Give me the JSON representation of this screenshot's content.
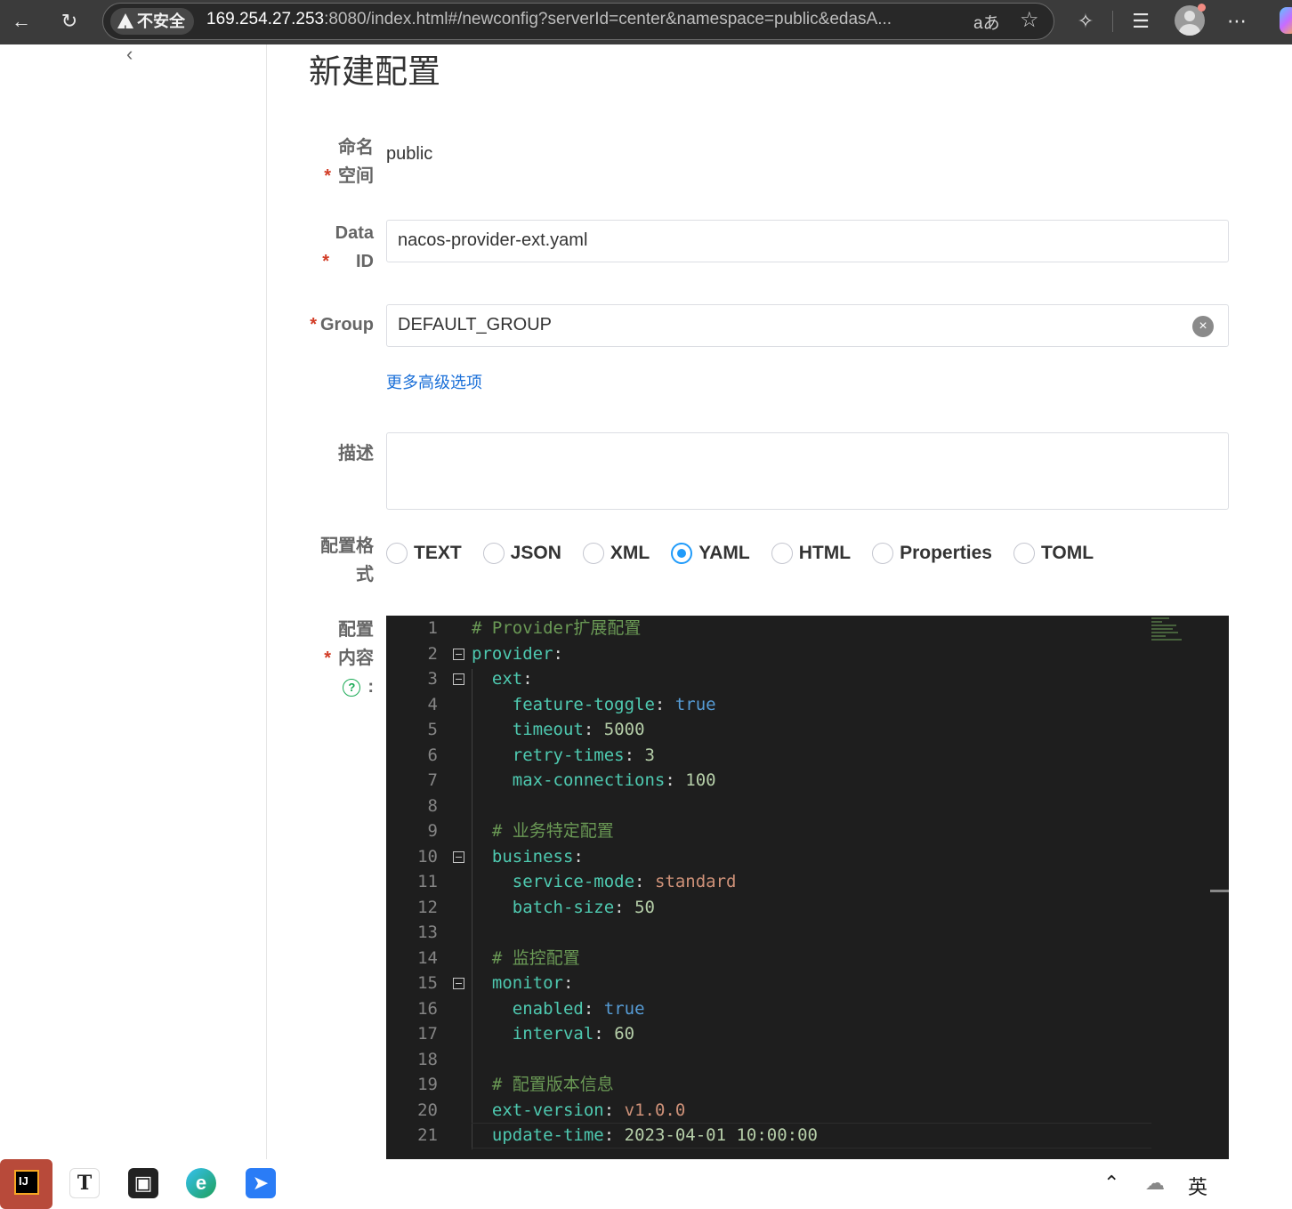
{
  "browser": {
    "security_label": "不安全",
    "url_host": "169.254.27.253",
    "url_rest": ":8080/index.html#/newconfig?serverId=center&namespace=public&edasA...",
    "read_aloud": "aあ"
  },
  "page": {
    "title": "新建配置"
  },
  "form": {
    "namespace": {
      "required": "*",
      "label": "命名空间",
      "value": "public"
    },
    "data_id": {
      "required": "*",
      "label": "Data ID",
      "value": "nacos-provider-ext.yaml"
    },
    "group": {
      "required": "*",
      "label": "Group",
      "value": "DEFAULT_GROUP"
    },
    "advanced_link": "更多高级选项",
    "description": {
      "label": "描述",
      "value": ""
    },
    "format": {
      "label": "配置格式",
      "options": [
        "TEXT",
        "JSON",
        "XML",
        "YAML",
        "HTML",
        "Properties",
        "TOML"
      ],
      "selected": "YAML"
    },
    "content": {
      "required": "*",
      "label": "配置内容",
      "help": "?",
      "colon": ":"
    }
  },
  "editor": {
    "lines": [
      {
        "n": "1",
        "text": "# Provider扩展配置"
      },
      {
        "n": "2",
        "text": "provider:"
      },
      {
        "n": "3",
        "text": "  ext:"
      },
      {
        "n": "4",
        "text": "    feature-toggle: true"
      },
      {
        "n": "5",
        "text": "    timeout: 5000"
      },
      {
        "n": "6",
        "text": "    retry-times: 3"
      },
      {
        "n": "7",
        "text": "    max-connections: 100"
      },
      {
        "n": "8",
        "text": ""
      },
      {
        "n": "9",
        "text": "  # 业务特定配置"
      },
      {
        "n": "10",
        "text": "  business:"
      },
      {
        "n": "11",
        "text": "    service-mode: standard"
      },
      {
        "n": "12",
        "text": "    batch-size: 50"
      },
      {
        "n": "13",
        "text": ""
      },
      {
        "n": "14",
        "text": "  # 监控配置"
      },
      {
        "n": "15",
        "text": "  monitor:"
      },
      {
        "n": "16",
        "text": "    enabled: true"
      },
      {
        "n": "17",
        "text": "    interval: 60"
      },
      {
        "n": "18",
        "text": ""
      },
      {
        "n": "19",
        "text": "  # 配置版本信息"
      },
      {
        "n": "20",
        "text": "  ext-version: v1.0.0"
      },
      {
        "n": "21",
        "text": "  update-time: 2023-04-01 10:00:00"
      }
    ],
    "fold_lines": [
      "2",
      "3",
      "10",
      "15"
    ]
  },
  "taskbar": {
    "apps": [
      "intellij-idea",
      "typora",
      "cube-app",
      "edge",
      "feishu"
    ],
    "tray_ime": "英"
  },
  "colors": {
    "accent": "#209bfa",
    "link": "#1a6fd8",
    "required": "#d23c26",
    "editor_bg": "#1e1e1e"
  }
}
